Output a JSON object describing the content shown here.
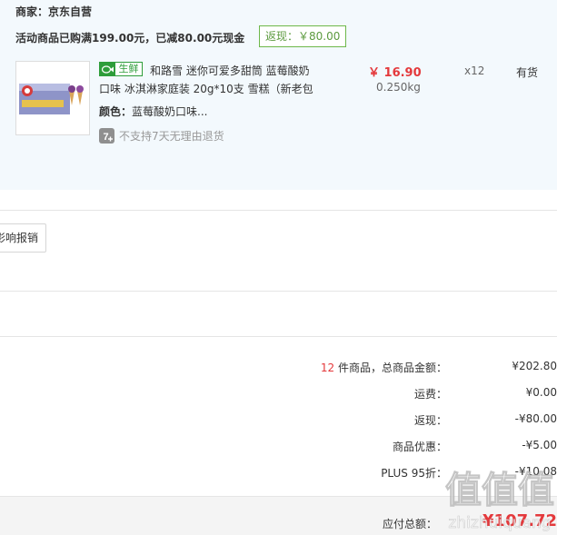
{
  "order": {
    "merchant": "商家：京东自营",
    "promo": "活动商品已购满199.00元，已减80.00元现金",
    "rebate_badge": "返现：￥80.00"
  },
  "product": {
    "fresh_tag": "生鲜",
    "title": "和路雪 迷你可爱多甜筒 蓝莓酸奶口味 冰淇淋家庭装 20g*10支 雪糕（新老包",
    "color_label": "颜色：",
    "color_value": "蓝莓酸奶口味...",
    "no_return_icon_text": "7",
    "no_return": "不支持7天无理由退货",
    "price": "￥ 16.90",
    "weight": "0.250kg",
    "quantity": "x12",
    "stock": "有货"
  },
  "invoice": {
    "button_label": "影响报销"
  },
  "summary": {
    "count": "12",
    "items_label_suffix": " 件商品，总商品金额：",
    "items_total": "¥202.80",
    "shipping_label": "运费：",
    "shipping_value": "¥0.00",
    "rebate_label": "返现：",
    "rebate_value": "-¥80.00",
    "discount_label": "商品优惠：",
    "discount_value": "-¥5.00",
    "plus_label": "PLUS 95折：",
    "plus_value": "-¥10.08"
  },
  "footer": {
    "payable_label": "应付总额：",
    "payable_amount": "¥107.72"
  },
  "watermark": {
    "logo_text": "值值值",
    "domain_text": "zhizhuiquang"
  },
  "colors": {
    "panel_bg": "#f3f9fd",
    "price_red": "#e4393c",
    "fresh_green": "#2e9d3a",
    "rebate_green": "#6db84a"
  },
  "icons": {
    "fresh_tag": "fish-icon",
    "no_return": "no-return-7-icon"
  }
}
